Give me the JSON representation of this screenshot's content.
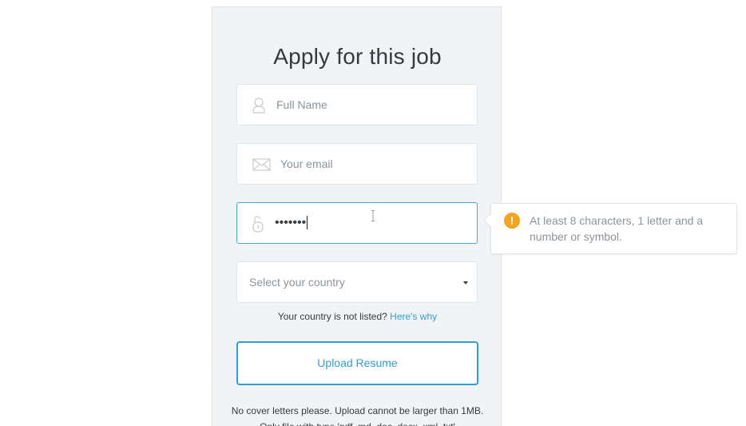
{
  "form": {
    "title": "Apply for this job",
    "full_name": {
      "placeholder": "Full Name",
      "icon": "user-icon"
    },
    "email": {
      "placeholder": "Your email",
      "icon": "envelope-icon"
    },
    "password": {
      "value": "•••••••",
      "icon": "unlock-icon"
    },
    "country": {
      "placeholder": "Select your country",
      "icon": "chevron-down-icon"
    },
    "country_note": "Your country is not listed?",
    "country_link": "Here's why",
    "upload_label": "Upload Resume",
    "file_note": "No cover letters please. Upload cannot be larger than 1MB. Only file with type 'pdf, md, doc, docx, xml, txt'"
  },
  "tooltip": {
    "icon": "warning-icon",
    "icon_glyph": "!",
    "text": "At least 8 characters, 1 letter and a number or symbol."
  },
  "colors": {
    "accent": "#2f9fd6",
    "panel_bg": "#f1f4f7",
    "warning": "#f3a51f"
  }
}
